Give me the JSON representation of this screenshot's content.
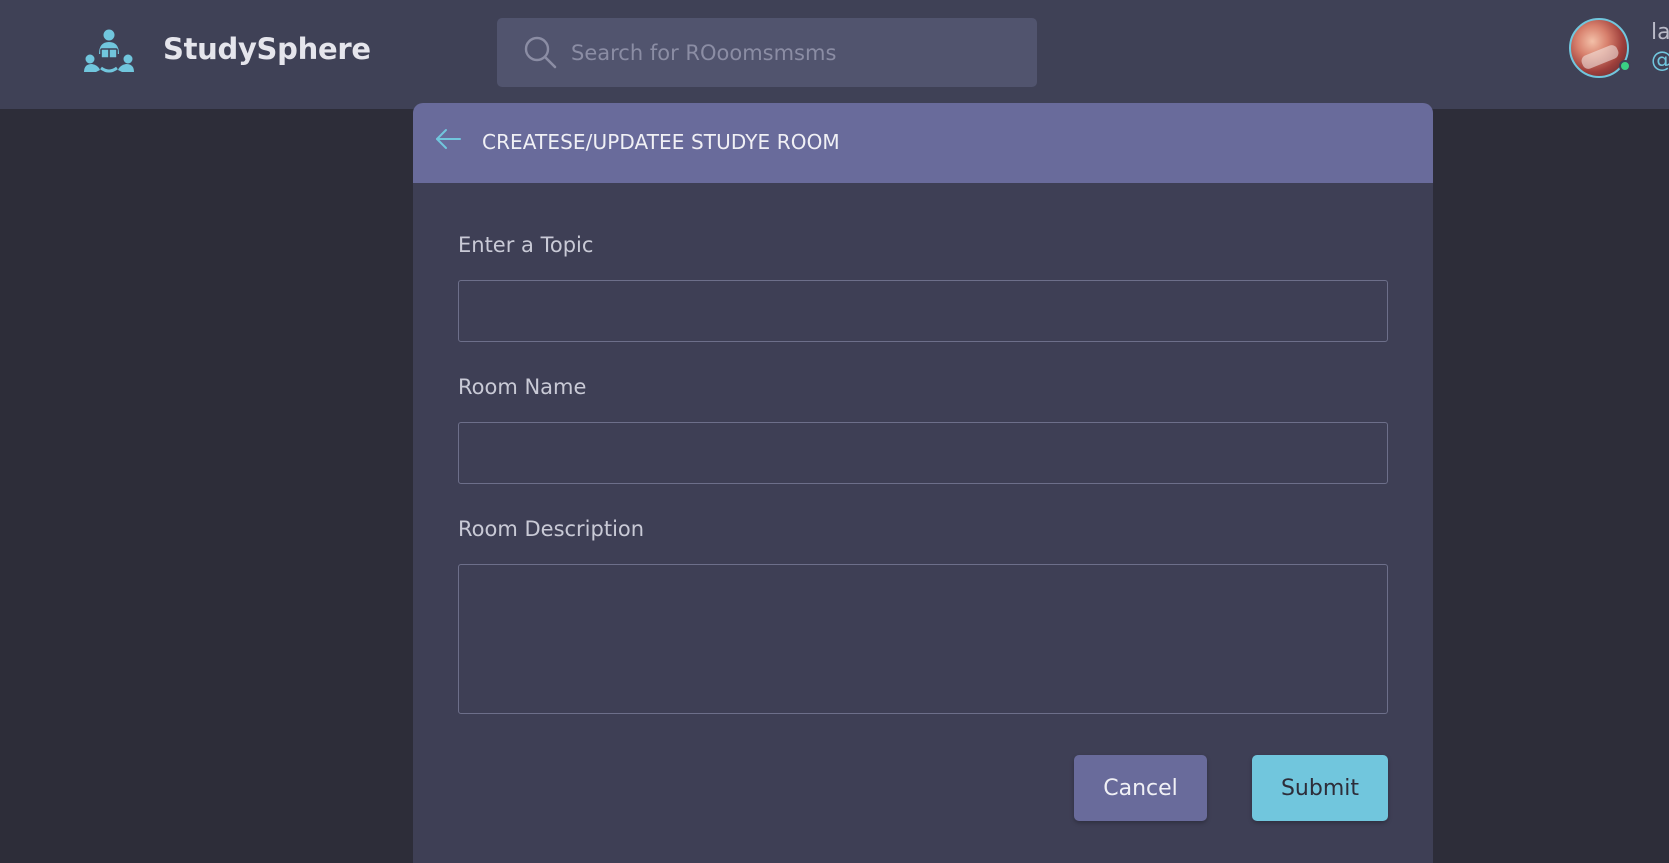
{
  "app": {
    "brand": "StudySphere",
    "logo_icon": "study-group-icon",
    "accent_color": "#71c6dd",
    "header_color": "#696b9b"
  },
  "search": {
    "placeholder": "Search for ROoomsmsms",
    "value": "",
    "icon": "search-icon"
  },
  "user": {
    "name": "la",
    "handle": "@",
    "status": "online",
    "avatar_icon": "avatar"
  },
  "form": {
    "title": "CREATESE/UPDATEE STUDYE ROOM",
    "back_icon": "arrow-left-icon",
    "fields": [
      {
        "label": "Enter a Topic",
        "value": ""
      },
      {
        "label": "Room Name",
        "value": ""
      },
      {
        "label": "Room Description",
        "value": ""
      }
    ],
    "cancel_label": "Cancel",
    "submit_label": "Submit"
  }
}
